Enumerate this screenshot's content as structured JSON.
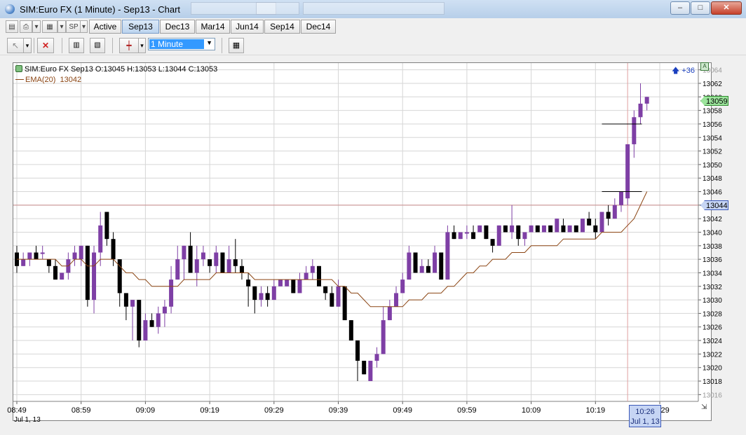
{
  "window": {
    "title": "SIM:Euro FX (1 Minute) - Sep13 - Chart",
    "controls": {
      "minimize": "–",
      "maximize": "□",
      "close": "✕"
    }
  },
  "toolbar1": {
    "instrument_label": "SP",
    "contract_tabs": [
      {
        "label": "Active",
        "selected": false
      },
      {
        "label": "Sep13",
        "selected": true
      },
      {
        "label": "Dec13",
        "selected": false
      },
      {
        "label": "Mar14",
        "selected": false
      },
      {
        "label": "Jun14",
        "selected": false
      },
      {
        "label": "Sep14",
        "selected": false
      },
      {
        "label": "Dec14",
        "selected": false
      }
    ]
  },
  "toolbar2": {
    "interval_value": "1 Minute"
  },
  "header": {
    "instrument_info": "SIM:Euro FX Sep13 O:13045 H:13053 L:13044 C:13053",
    "indicator_label": "EMA(20)",
    "indicator_value": "13042",
    "offset_label": "+36",
    "autoscale_label": "A"
  },
  "markers": {
    "last_price": "13059",
    "horizontal_line_price": "13044",
    "cursor_time": "10:26",
    "cursor_date": "Jul 1, 13",
    "first_date": "Jul 1, 13"
  },
  "colors": {
    "up_candle": "#7e3fa5",
    "down_candle": "#000000",
    "ema": "#8b4513",
    "hline": "#c98a8a",
    "last_price_tag": "#9be49b",
    "hline_tag": "#c6d5f4"
  },
  "chart_data": {
    "type": "candlestick",
    "ylim": [
      13015,
      13065
    ],
    "y_ticks": [
      13016,
      13018,
      13020,
      13022,
      13024,
      13026,
      13028,
      13030,
      13032,
      13034,
      13036,
      13038,
      13040,
      13042,
      13044,
      13046,
      13048,
      13050,
      13052,
      13054,
      13056,
      13058,
      13060,
      13062,
      13064
    ],
    "x_tick_labels": [
      "08:49",
      "08:59",
      "09:09",
      "09:19",
      "09:29",
      "09:39",
      "09:49",
      "09:59",
      "10:09",
      "10:19",
      "10:29"
    ],
    "candles": [
      [
        13037,
        13038,
        13034,
        13035
      ],
      [
        13035,
        13037,
        13035,
        13036
      ],
      [
        13036,
        13037,
        13035,
        13037
      ],
      [
        13037,
        13038,
        13036,
        13036
      ],
      [
        13037,
        13038,
        13036,
        13037
      ],
      [
        13036,
        13036,
        13034,
        13035
      ],
      [
        13035,
        13036,
        13033,
        13033
      ],
      [
        13033,
        13034,
        13033,
        13034
      ],
      [
        13034,
        13037,
        13033,
        13036
      ],
      [
        13036,
        13038,
        13035,
        13037
      ],
      [
        13036,
        13038,
        13035,
        13038
      ],
      [
        13038,
        13038,
        13029,
        13030
      ],
      [
        13030,
        13038,
        13028,
        13037
      ],
      [
        13037,
        13043,
        13035,
        13041
      ],
      [
        13043,
        13043,
        13038,
        13039
      ],
      [
        13039,
        13040,
        13035,
        13036
      ],
      [
        13036,
        13036,
        13029,
        13031
      ],
      [
        13031,
        13031,
        13027,
        13029
      ],
      [
        13029,
        13030,
        13024,
        13030
      ],
      [
        13030,
        13030,
        13023,
        13024
      ],
      [
        13024,
        13028,
        13024,
        13027
      ],
      [
        13027,
        13028,
        13026,
        13026
      ],
      [
        13026,
        13029,
        13025,
        13028
      ],
      [
        13028,
        13030,
        13026,
        13029
      ],
      [
        13029,
        13035,
        13028,
        13033
      ],
      [
        13033,
        13038,
        13033,
        13036
      ],
      [
        13036,
        13038,
        13033,
        13038
      ],
      [
        13038,
        13040,
        13034,
        13034
      ],
      [
        13034,
        13038,
        13032,
        13036
      ],
      [
        13036,
        13038,
        13035,
        13037
      ],
      [
        13036,
        13036,
        13034,
        13035
      ],
      [
        13035,
        13038,
        13034,
        13037
      ],
      [
        13037,
        13037,
        13034,
        13034
      ],
      [
        13034,
        13038,
        13034,
        13036
      ],
      [
        13036,
        13039,
        13034,
        13035
      ],
      [
        13035,
        13036,
        13033,
        13034
      ],
      [
        13033,
        13034,
        13029,
        13032
      ],
      [
        13032,
        13032,
        13028,
        13030
      ],
      [
        13030,
        13032,
        13029,
        13031
      ],
      [
        13031,
        13032,
        13029,
        13030
      ],
      [
        13030,
        13033,
        13030,
        13032
      ],
      [
        13032,
        13033,
        13032,
        13033
      ],
      [
        13032,
        13033,
        13032,
        13033
      ],
      [
        13033,
        13033,
        13031,
        13031
      ],
      [
        13031,
        13034,
        13031,
        13033
      ],
      [
        13033,
        13035,
        13033,
        13034
      ],
      [
        13034,
        13036,
        13033,
        13035
      ],
      [
        13035,
        13035,
        13032,
        13032
      ],
      [
        13032,
        13032,
        13030,
        13031
      ],
      [
        13031,
        13032,
        13029,
        13029
      ],
      [
        13029,
        13033,
        13029,
        13032
      ],
      [
        13032,
        13032,
        13028,
        13027
      ],
      [
        13027,
        13027,
        13024,
        13024
      ],
      [
        13024,
        13024,
        13018,
        13021
      ],
      [
        13021,
        13021,
        13019,
        13019
      ],
      [
        13018,
        13021,
        13018,
        13021
      ],
      [
        13021,
        13023,
        13020,
        13022
      ],
      [
        13022,
        13029,
        13022,
        13027
      ],
      [
        13027,
        13030,
        13027,
        13029
      ],
      [
        13029,
        13032,
        13029,
        13031
      ],
      [
        13031,
        13034,
        13031,
        13033
      ],
      [
        13033,
        13038,
        13033,
        13037
      ],
      [
        13037,
        13037,
        13034,
        13034
      ],
      [
        13034,
        13036,
        13034,
        13035
      ],
      [
        13035,
        13036,
        13034,
        13034
      ],
      [
        13034,
        13038,
        13034,
        13037
      ],
      [
        13037,
        13037,
        13033,
        13033
      ],
      [
        13033,
        13041,
        13033,
        13040
      ],
      [
        13040,
        13041,
        13039,
        13039
      ],
      [
        13039,
        13040,
        13039,
        13040
      ],
      [
        13040,
        13041,
        13039,
        13040
      ],
      [
        13040,
        13041,
        13039,
        13039
      ],
      [
        13040,
        13041,
        13040,
        13041
      ],
      [
        13041,
        13041,
        13039,
        13039
      ],
      [
        13039,
        13039,
        13037,
        13038
      ],
      [
        13038,
        13041,
        13038,
        13041
      ],
      [
        13041,
        13041,
        13040,
        13040
      ],
      [
        13040,
        13044,
        13039,
        13041
      ],
      [
        13041,
        13041,
        13038,
        13039
      ],
      [
        13039,
        13040,
        13038,
        13040
      ],
      [
        13040,
        13041,
        13040,
        13041
      ],
      [
        13041,
        13041,
        13040,
        13040
      ],
      [
        13040,
        13041,
        13040,
        13041
      ],
      [
        13041,
        13041,
        13040,
        13040
      ],
      [
        13040,
        13042,
        13040,
        13042
      ],
      [
        13041,
        13042,
        13040,
        13040
      ],
      [
        13040,
        13041,
        13040,
        13041
      ],
      [
        13041,
        13041,
        13040,
        13040
      ],
      [
        13040,
        13042,
        13040,
        13042
      ],
      [
        13042,
        13043,
        13041,
        13041
      ],
      [
        13041,
        13042,
        13039,
        13040
      ],
      [
        13040,
        13043,
        13040,
        13043
      ],
      [
        13043,
        13044,
        13041,
        13042
      ],
      [
        13042,
        13045,
        13042,
        13044
      ],
      [
        13044,
        13046,
        13043,
        13046
      ],
      [
        13045,
        13053,
        13044,
        13053
      ],
      [
        13053,
        13058,
        13051,
        13057
      ],
      [
        13057,
        13062,
        13056,
        13059
      ],
      [
        13059,
        13060,
        13058,
        13060
      ]
    ],
    "ema20": [
      13036,
      13036,
      13036,
      13036,
      13036,
      13036,
      13036,
      13035,
      13035,
      13036,
      13036,
      13035,
      13035,
      13036,
      13036,
      13036,
      13035,
      13034,
      13034,
      13033,
      13033,
      13032,
      13032,
      13032,
      13032,
      13032,
      13033,
      13033,
      13033,
      13033,
      13033,
      13034,
      13034,
      13034,
      13034,
      13034,
      13034,
      13033,
      13033,
      13033,
      13033,
      13033,
      13033,
      13033,
      13033,
      13033,
      13033,
      13033,
      13033,
      13033,
      13032,
      13032,
      13031,
      13031,
      13030,
      13029,
      13029,
      13029,
      13029,
      13029,
      13029,
      13030,
      13030,
      13030,
      13031,
      13031,
      13031,
      13032,
      13032,
      13033,
      13034,
      13034,
      13035,
      13035,
      13036,
      13036,
      13036,
      13037,
      13037,
      13037,
      13038,
      13038,
      13038,
      13038,
      13038,
      13039,
      13039,
      13039,
      13039,
      13039,
      13039,
      13040,
      13040,
      13040,
      13040,
      13041,
      13042,
      13044,
      13046
    ],
    "hline_value": 13044,
    "trendlines": [
      [
        13056,
        13056
      ],
      [
        13046,
        13046
      ]
    ]
  }
}
